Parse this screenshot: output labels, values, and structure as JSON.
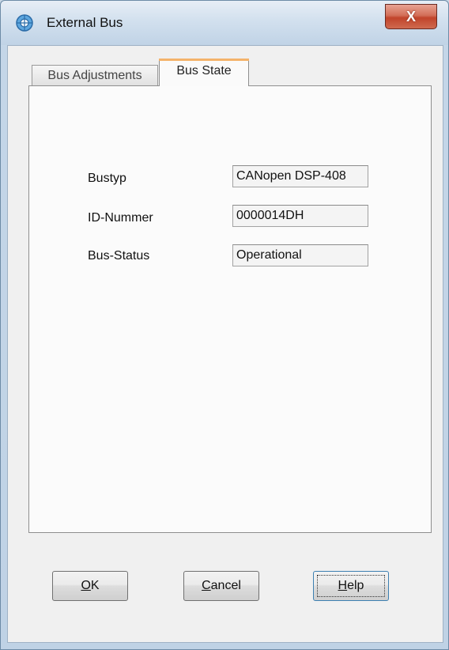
{
  "window": {
    "title": "External Bus",
    "close_label": "X"
  },
  "tabs": [
    {
      "label": "Bus Adjustments",
      "active": false
    },
    {
      "label": "Bus State",
      "active": true
    }
  ],
  "fields": [
    {
      "label": "Bustyp",
      "value": "CANopen DSP-408"
    },
    {
      "label": "ID-Nummer",
      "value": "0000014DH"
    },
    {
      "label": "Bus-Status",
      "value": "Operational"
    }
  ],
  "buttons": {
    "ok": {
      "mnemonic": "O",
      "rest": "K"
    },
    "cancel": {
      "mnemonic": "C",
      "rest": "ancel"
    },
    "help": {
      "mnemonic": "H",
      "rest": "elp"
    }
  },
  "colors": {
    "tab_accent": "#f4b36b",
    "close_button": "#c1442b"
  },
  "icons": {
    "title": "bus-network-icon",
    "close": "close-icon"
  }
}
